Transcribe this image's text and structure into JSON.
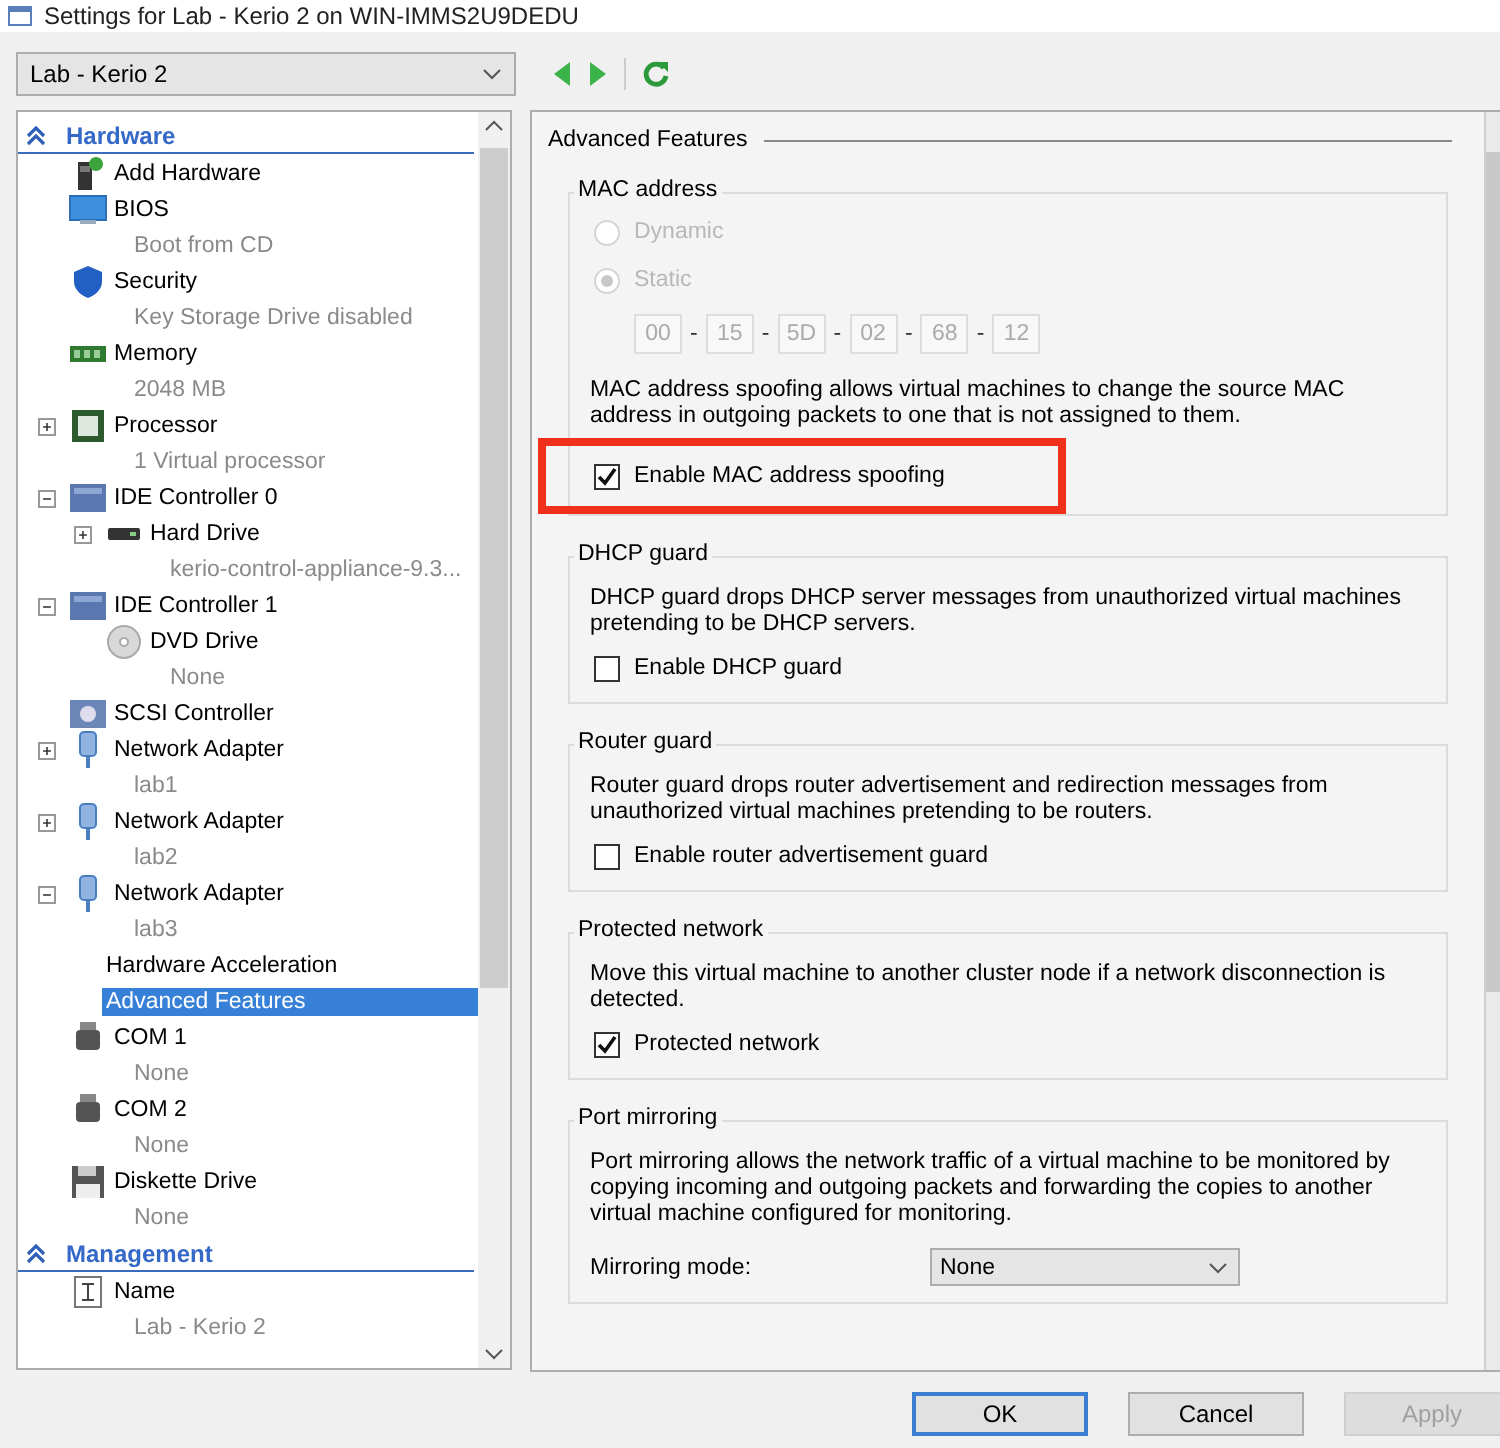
{
  "window": {
    "title": "Settings for Lab - Kerio 2 on WIN-IMMS2U9DEDU"
  },
  "vm_selector": {
    "value": "Lab - Kerio 2"
  },
  "tree": {
    "sections": [
      {
        "title": "Hardware",
        "expanded": true,
        "items": [
          {
            "kind": "addhw",
            "label": "Add Hardware",
            "selected": false
          },
          {
            "kind": "bios",
            "label": "BIOS",
            "detail": "Boot from CD",
            "selected": false
          },
          {
            "kind": "security",
            "label": "Security",
            "detail": "Key Storage Drive disabled",
            "selected": false
          },
          {
            "kind": "memory",
            "label": "Memory",
            "detail": "2048 MB",
            "selected": false
          },
          {
            "kind": "processor",
            "label": "Processor",
            "detail": "1 Virtual processor",
            "expanded": false,
            "selected": false
          },
          {
            "kind": "ide",
            "label": "IDE Controller 0",
            "expanded": true,
            "selected": false,
            "children": [
              {
                "kind": "disk",
                "label": "Hard Drive",
                "detail": "kerio-control-appliance-9.3...",
                "expanded": false,
                "selected": false
              }
            ]
          },
          {
            "kind": "ide",
            "label": "IDE Controller 1",
            "expanded": true,
            "selected": false,
            "children": [
              {
                "kind": "dvd",
                "label": "DVD Drive",
                "detail": "None",
                "selected": false
              }
            ]
          },
          {
            "kind": "scsi",
            "label": "SCSI Controller",
            "selected": false
          },
          {
            "kind": "network",
            "label": "Network Adapter",
            "detail": "lab1",
            "expanded": false,
            "selected": false
          },
          {
            "kind": "network",
            "label": "Network Adapter",
            "detail": "lab2",
            "expanded": false,
            "selected": false
          },
          {
            "kind": "network",
            "label": "Network Adapter",
            "detail": "lab3",
            "expanded": true,
            "selected": false,
            "children": [
              {
                "kind": "plain",
                "label": "Hardware Acceleration",
                "selected": false
              },
              {
                "kind": "plain",
                "label": "Advanced Features",
                "selected": true
              }
            ]
          },
          {
            "kind": "com",
            "label": "COM 1",
            "detail": "None",
            "selected": false
          },
          {
            "kind": "com",
            "label": "COM 2",
            "detail": "None",
            "selected": false
          },
          {
            "kind": "floppy",
            "label": "Diskette Drive",
            "detail": "None",
            "selected": false
          }
        ]
      },
      {
        "title": "Management",
        "expanded": true,
        "items": [
          {
            "kind": "name",
            "label": "Name",
            "detail": "Lab - Kerio 2",
            "selected": false
          }
        ]
      }
    ]
  },
  "panel": {
    "title": "Advanced Features",
    "groups": [
      {
        "title": "MAC address",
        "controls": [
          {
            "kind": "radio",
            "label": "Dynamic",
            "selected": false,
            "disabled": true
          },
          {
            "kind": "radio",
            "label": "Static",
            "selected": true,
            "disabled": true
          },
          {
            "kind": "mac",
            "octets": [
              "00",
              "15",
              "5D",
              "02",
              "68",
              "12"
            ],
            "separators": [
              "-",
              "-",
              "-",
              "-",
              "-"
            ],
            "disabled": true
          },
          {
            "kind": "text",
            "text": "MAC address spoofing allows virtual machines to change the source MAC address in outgoing packets to one that is not assigned to them."
          },
          {
            "kind": "checkbox",
            "label": "Enable MAC address spoofing",
            "checked": true,
            "highlighted": true
          }
        ]
      },
      {
        "title": "DHCP guard",
        "controls": [
          {
            "kind": "text",
            "text": "DHCP guard drops DHCP server messages from unauthorized virtual machines pretending to be DHCP servers."
          },
          {
            "kind": "checkbox",
            "label": "Enable DHCP guard",
            "checked": false,
            "highlighted": false
          }
        ]
      },
      {
        "title": "Router guard",
        "controls": [
          {
            "kind": "text",
            "text": "Router guard drops router advertisement and redirection messages from unauthorized virtual machines pretending to be routers."
          },
          {
            "kind": "checkbox",
            "label": "Enable router advertisement guard",
            "checked": false,
            "highlighted": false
          }
        ]
      },
      {
        "title": "Protected network",
        "controls": [
          {
            "kind": "text",
            "text": "Move this virtual machine to another cluster node if a network disconnection is detected."
          },
          {
            "kind": "checkbox",
            "label": "Protected network",
            "checked": true,
            "highlighted": false
          }
        ]
      },
      {
        "title": "Port mirroring",
        "controls": [
          {
            "kind": "text",
            "text": "Port mirroring allows the network traffic of a virtual machine to be monitored by copying incoming and outgoing packets and forwarding the copies to another virtual machine configured for monitoring."
          },
          {
            "kind": "select",
            "label": "Mirroring mode:",
            "value": "None"
          }
        ]
      }
    ]
  },
  "buttons": [
    {
      "label": "OK",
      "default": true,
      "disabled": false
    },
    {
      "label": "Cancel",
      "default": false,
      "disabled": false
    },
    {
      "label": "Apply",
      "default": false,
      "disabled": true
    }
  ]
}
